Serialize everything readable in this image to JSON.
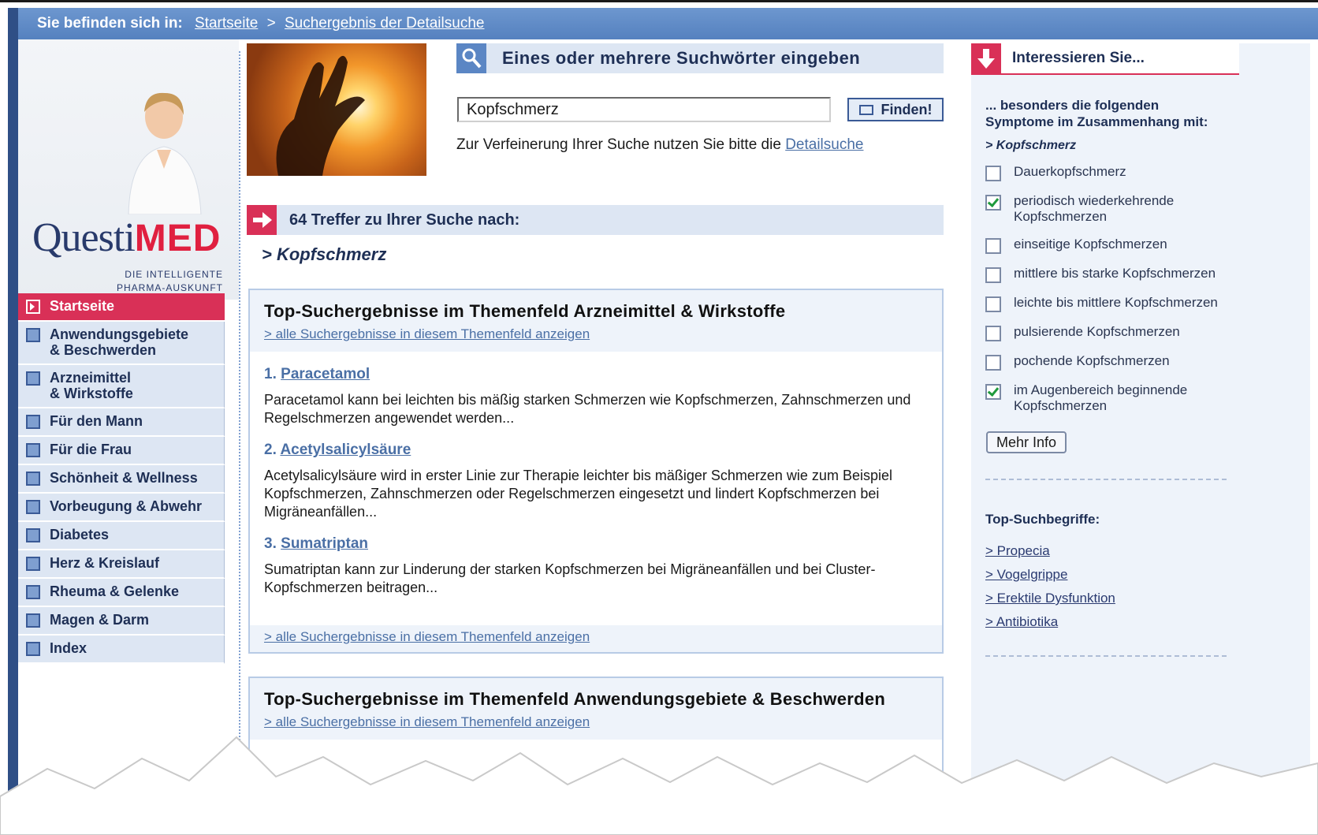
{
  "breadcrumb": {
    "label": "Sie befinden sich in:",
    "items": [
      "Startseite",
      "Suchergebnis der Detailsuche"
    ],
    "separator": ">"
  },
  "logo": {
    "part1": "Questi",
    "part2": "MED",
    "tagline_line1": "DIE INTELLIGENTE",
    "tagline_line2": "PHARMA-AUSKUNFT"
  },
  "nav": {
    "items": [
      {
        "label": "Startseite",
        "active": true
      },
      {
        "label": "Anwendungsgebiete & Beschwerden",
        "line1": "Anwendungsgebiete",
        "line2": "& Beschwerden"
      },
      {
        "label": "Arzneimittel & Wirkstoffe",
        "line1": "Arzneimittel",
        "line2": "& Wirkstoffe"
      },
      {
        "label": "Für den Mann"
      },
      {
        "label": "Für die Frau"
      },
      {
        "label": "Schönheit & Wellness"
      },
      {
        "label": "Vorbeugung & Abwehr"
      },
      {
        "label": "Diabetes"
      },
      {
        "label": "Herz & Kreislauf"
      },
      {
        "label": "Rheuma & Gelenke"
      },
      {
        "label": "Magen & Darm"
      },
      {
        "label": "Index"
      }
    ]
  },
  "search": {
    "heading": "Eines oder mehrere Suchwörter eingeben",
    "value": "Kopfschmerz",
    "button": "Finden!",
    "hint": "Zur Verfeinerung Ihrer Suche nutzen Sie bitte die",
    "hint_link": "Detailsuche"
  },
  "results": {
    "heading": "64 Treffer zu Ihrer Suche nach:",
    "query": "> Kopfschmerz"
  },
  "box1": {
    "title": "Top-Suchergebnisse im Themenfeld Arzneimittel & Wirkstoffe",
    "link": "> alle Suchergebnisse in diesem Themenfeld anzeigen",
    "items": [
      {
        "num": "1.",
        "name": "Paracetamol",
        "text": "Paracetamol kann bei leichten bis mäßig starken Schmerzen wie Kopfschmerzen, Zahnschmerzen und Regelschmerzen angewendet werden..."
      },
      {
        "num": "2.",
        "name": "Acetylsalicylsäure",
        "text": "Acetylsalicylsäure wird in erster Linie zur Therapie leichter bis mäßiger Schmerzen wie zum Beispiel Kopfschmerzen, Zahnschmerzen oder Regelschmerzen eingesetzt und lindert Kopfschmerzen bei Migräneanfällen..."
      },
      {
        "num": "3.",
        "name": "Sumatriptan",
        "text": "Sumatriptan kann zur Linderung der starken Kopfschmerzen bei Migräneanfällen und bei Cluster-Kopfschmerzen beitragen..."
      }
    ],
    "footer_link": "> alle Suchergebnisse in diesem Themenfeld anzeigen"
  },
  "box2": {
    "title": "Top-Suchergebnisse im Themenfeld Anwendungsgebiete & Beschwerden",
    "link": "> alle Suchergebnisse in diesem Themenfeld anzeigen"
  },
  "sidebar": {
    "heading": "Interessieren Sie...",
    "intro_line1": "... besonders die folgenden",
    "intro_line2": "Symptome im Zusammenhang mit:",
    "query": "> Kopfschmerz",
    "symptoms": [
      {
        "label": "Dauerkopfschmerz",
        "checked": false
      },
      {
        "label": "periodisch wiederkehrende Kopfschmerzen",
        "checked": true
      },
      {
        "label": "einseitige Kopfschmerzen",
        "checked": false
      },
      {
        "label": "mittlere bis starke Kopfschmerzen",
        "checked": false
      },
      {
        "label": "leichte bis mittlere Kopfschmerzen",
        "checked": false
      },
      {
        "label": "pulsierende Kopfschmerzen",
        "checked": false
      },
      {
        "label": "pochende Kopfschmerzen",
        "checked": false
      },
      {
        "label": "im Augenbereich beginnende Kopfschmerzen",
        "checked": true
      }
    ],
    "more_button": "Mehr Info",
    "top_heading": "Top-Suchbegriffe:",
    "top_terms": [
      "> Propecia",
      "> Vogelgrippe",
      "> Erektile Dysfunktion",
      "> Antibiotika"
    ]
  },
  "colors": {
    "accent_blue": "#5b86c4",
    "accent_red": "#d93057",
    "panel_bg": "#dde6f3",
    "link": "#4a6fa5"
  }
}
